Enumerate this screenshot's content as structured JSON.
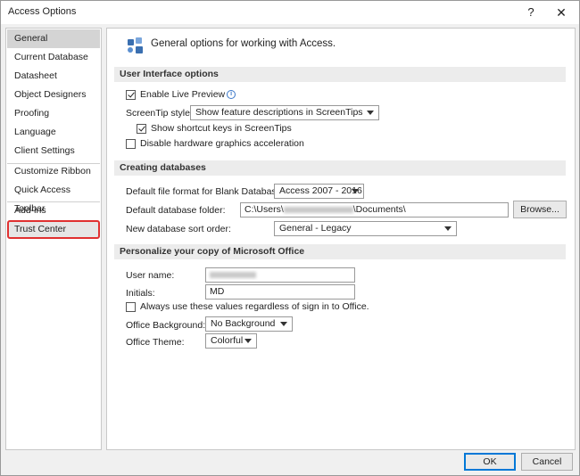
{
  "window": {
    "title": "Access Options",
    "help": "?",
    "close": "✕"
  },
  "sidebar": {
    "items": [
      {
        "label": "General"
      },
      {
        "label": "Current Database"
      },
      {
        "label": "Datasheet"
      },
      {
        "label": "Object Designers"
      },
      {
        "label": "Proofing"
      },
      {
        "label": "Language"
      },
      {
        "label": "Client Settings"
      },
      {
        "label": "Customize Ribbon"
      },
      {
        "label": "Quick Access Toolbar"
      },
      {
        "label": "Add-ins"
      },
      {
        "label": "Trust Center"
      }
    ],
    "selected": "General",
    "highlighted": "Trust Center"
  },
  "header": {
    "text": "General options for working with Access."
  },
  "ui_options": {
    "title": "User Interface options",
    "live_preview_label": "Enable Live Preview",
    "live_preview_checked": true,
    "screentip_label": "ScreenTip style:",
    "screentip_value": "Show feature descriptions in ScreenTips",
    "shortcut_label": "Show shortcut keys in ScreenTips",
    "shortcut_checked": true,
    "hw_accel_label": "Disable hardware graphics acceleration",
    "hw_accel_checked": false
  },
  "creating": {
    "title": "Creating databases",
    "format_label": "Default file format for Blank Database:",
    "format_value": "Access 2007 - 2016",
    "folder_label": "Default database folder:",
    "folder_prefix": "C:\\Users\\",
    "folder_suffix": "\\Documents\\",
    "browse_label": "Browse...",
    "sort_label": "New database sort order:",
    "sort_value": "General - Legacy"
  },
  "personalize": {
    "title": "Personalize your copy of Microsoft Office",
    "username_label": "User name:",
    "initials_label": "Initials:",
    "initials_value": "MD",
    "always_use_label": "Always use these values regardless of sign in to Office.",
    "always_use_checked": false,
    "background_label": "Office Background:",
    "background_value": "No Background",
    "theme_label": "Office Theme:",
    "theme_value": "Colorful"
  },
  "footer": {
    "ok_label": "OK",
    "cancel_label": "Cancel"
  },
  "colors": {
    "highlight_border": "#e03030",
    "selected_bg": "#d4d4d4",
    "section_bg": "#ececec",
    "default_button_border": "#0078d7"
  }
}
